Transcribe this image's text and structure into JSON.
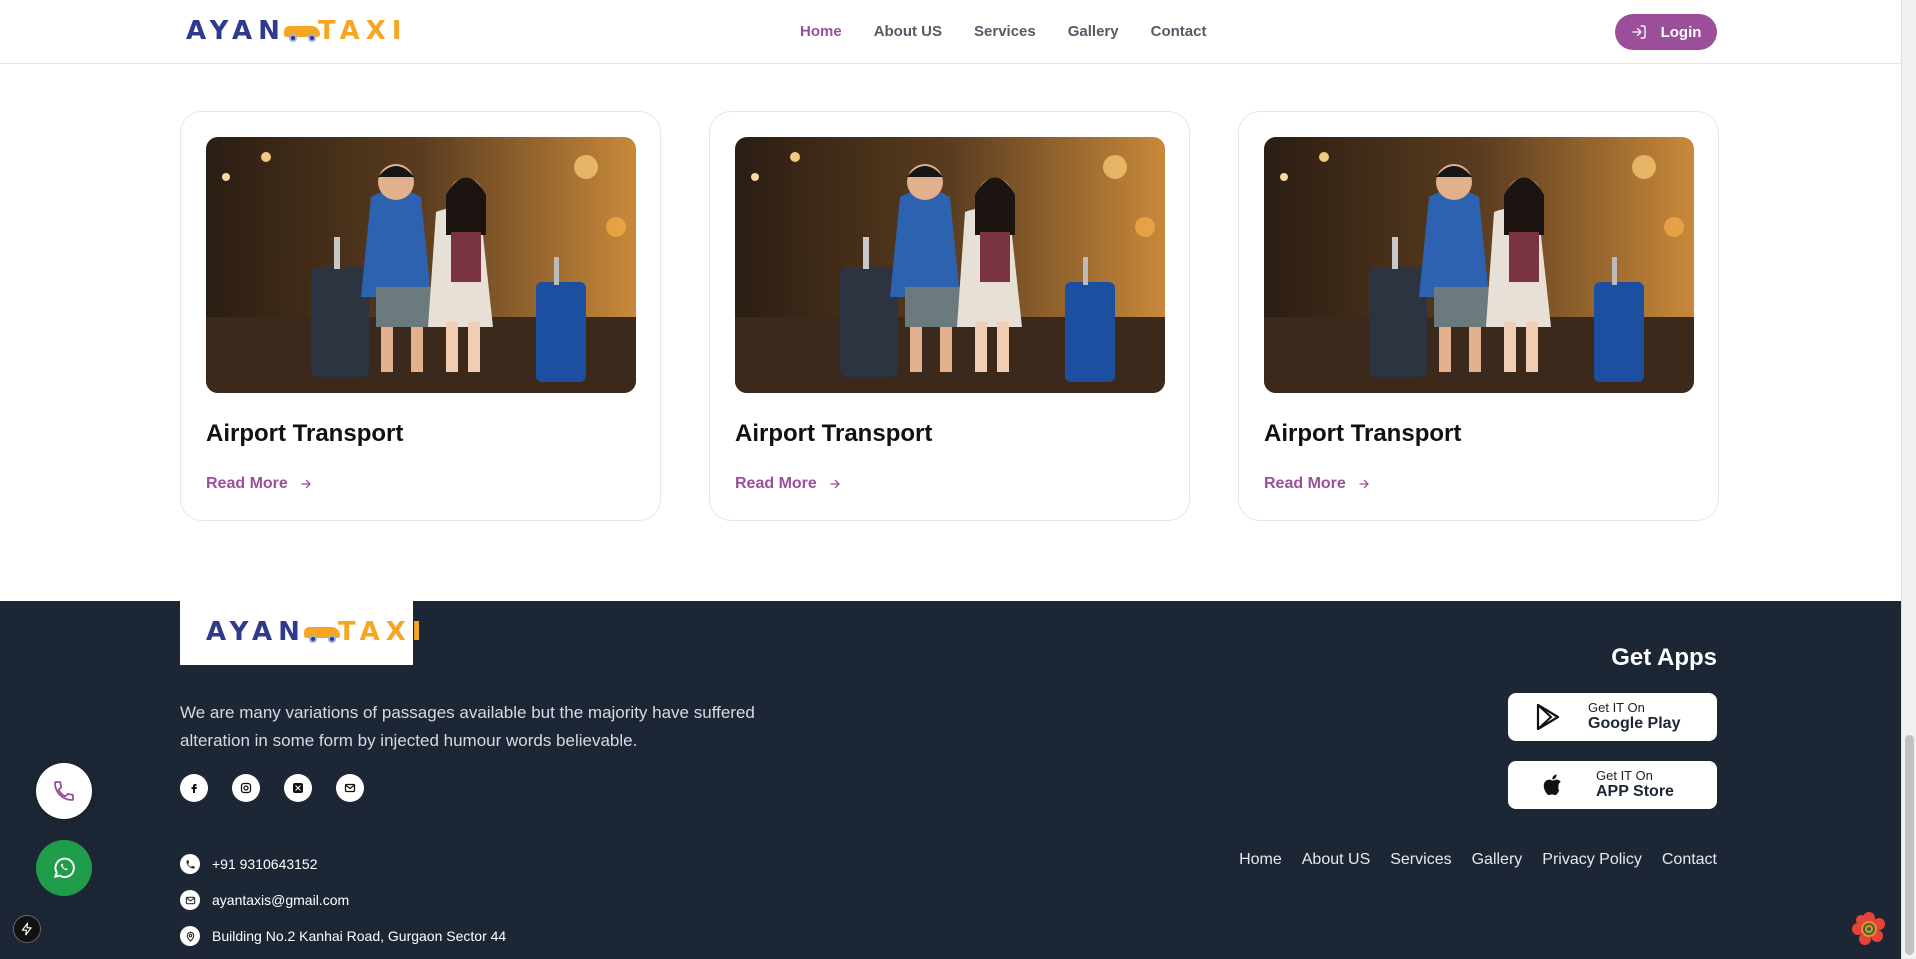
{
  "brand": {
    "part1": "AYAN",
    "part2": "TAXI",
    "primary_color": "#2e3a8c",
    "accent_color": "#f6a623"
  },
  "nav": {
    "items": [
      {
        "label": "Home",
        "active": true
      },
      {
        "label": "About US"
      },
      {
        "label": "Services"
      },
      {
        "label": "Gallery"
      },
      {
        "label": "Contact"
      }
    ],
    "active_color": "#9b4f9b"
  },
  "login": {
    "label": "Login",
    "icon": "login-icon",
    "color": "#9b4f9b"
  },
  "cards": [
    {
      "title": "Airport Transport",
      "link": "Read More",
      "image": "couple-with-luggage-photo"
    },
    {
      "title": "Airport Transport",
      "link": "Read More",
      "image": "couple-with-luggage-photo"
    },
    {
      "title": "Airport Transport",
      "link": "Read More",
      "image": "couple-with-luggage-photo"
    }
  ],
  "footer": {
    "background": "#1d2634",
    "about": "We are many variations of passages available but the majority have suffered alteration in some form by injected humour words believable.",
    "socials": [
      "facebook-icon",
      "instagram-icon",
      "twitter-x-icon",
      "mail-icon"
    ],
    "contacts": {
      "phone": "+91 9310643152",
      "email": "ayantaxis@gmail.com",
      "address": "Building No.2 Kanhai Road, Gurgaon Sector 44"
    },
    "get_apps": "Get Apps",
    "google_play": {
      "line1": "Get IT On",
      "line2": "Google Play"
    },
    "app_store": {
      "line1": "Get IT On",
      "line2": "APP Store"
    },
    "links": [
      "Home",
      "About US",
      "Services",
      "Gallery",
      "Privacy Policy",
      "Contact"
    ]
  },
  "floating": {
    "phone_icon": "phone-icon",
    "whatsapp_icon": "whatsapp-icon",
    "whatsapp_color": "#1f9d4a"
  }
}
